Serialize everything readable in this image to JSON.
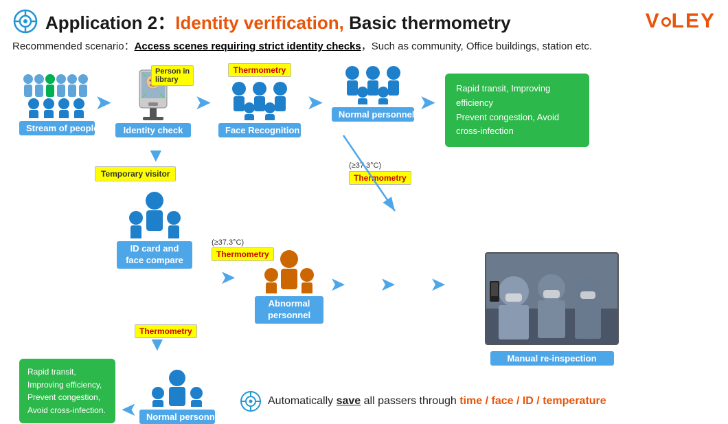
{
  "header": {
    "title_prefix": "Application 2：",
    "title_highlight": "Identity verification,",
    "title_suffix": " Basic thermometry",
    "logo": "VCLEY"
  },
  "scenario": {
    "prefix": "Recommended scenario：",
    "highlight": "Access scenes requiring strict identity checks",
    "suffix": "，Such as community, Office buildings, station etc."
  },
  "nodes": {
    "stream": "Stream of people",
    "identity": "Identity check",
    "face_recognition": "Face Recognition",
    "normal_personnel": "Normal personnel",
    "id_card": "ID card and\nface compare",
    "abnormal": "Abnormal\npersonnel",
    "manual": "Manual re-inspection",
    "normal_bottom": "Normal personnel"
  },
  "badges": {
    "person_in_library": "Person in\nlibrary",
    "thermometry": "Thermometry",
    "temporary_visitor": "Temporary visitor",
    "thermometry2": "Thermometry",
    "thermometry3": "Thermometry"
  },
  "green_boxes": {
    "top": "Rapid transit, Improving efficiency\nPrevent congestion, Avoid cross-infection",
    "bottom": "Rapid transit,\nImproving efficiency,\nPrevent congestion,\nAvoid cross-infection."
  },
  "temp": {
    "label1": "(≥37.3°C)",
    "label2": "(≥37.3°C)"
  },
  "summary": {
    "prefix": "Automatically ",
    "save": "save",
    "middle": " all passers through ",
    "highlights": "time / face / ID / temperature"
  }
}
